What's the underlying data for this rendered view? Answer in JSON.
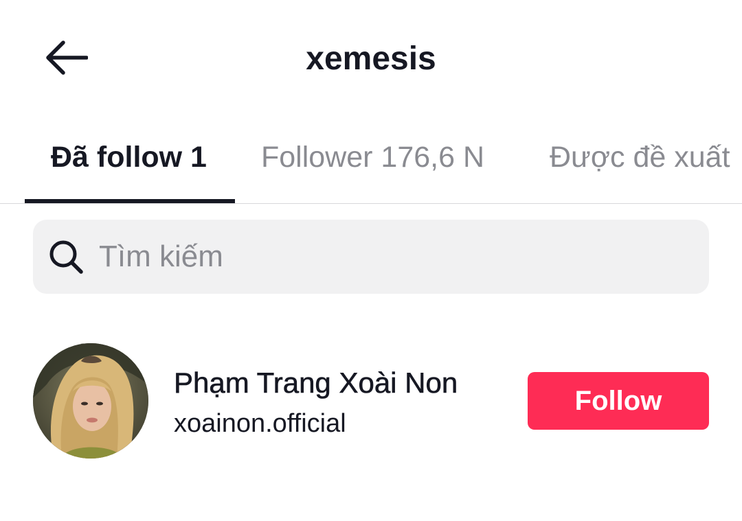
{
  "header": {
    "title": "xemesis",
    "back_icon": "arrow-left-icon"
  },
  "tabs": [
    {
      "label": "Đã follow 1",
      "active": true
    },
    {
      "label": "Follower 176,6 N",
      "active": false
    },
    {
      "label": "Được đề xuất",
      "active": false
    }
  ],
  "search": {
    "icon": "search-icon",
    "placeholder": "Tìm kiếm",
    "value": ""
  },
  "list": [
    {
      "name": "Phạm Trang Xoài Non",
      "handle": "xoainon.official",
      "follow_label": "Follow"
    }
  ],
  "colors": {
    "accent": "#fe2c55",
    "text_primary": "#161823",
    "text_secondary": "#8a8b91",
    "search_bg": "#f1f1f2"
  }
}
